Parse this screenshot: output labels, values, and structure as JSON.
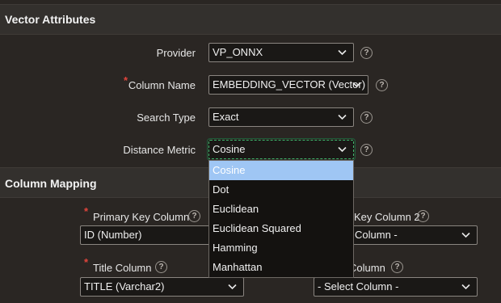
{
  "vector_attributes": {
    "title": "Vector Attributes",
    "provider": {
      "label": "Provider",
      "value": "VP_ONNX"
    },
    "column_name": {
      "label": "Column Name",
      "value": "EMBEDDING_VECTOR (Vector)"
    },
    "search_type": {
      "label": "Search Type",
      "value": "Exact"
    },
    "distance_metric": {
      "label": "Distance Metric",
      "value": "Cosine"
    },
    "required_marker": "*"
  },
  "distance_metric_options": [
    "Cosine",
    "Dot",
    "Euclidean",
    "Euclidean Squared",
    "Hamming",
    "Manhattan"
  ],
  "column_mapping": {
    "title": "Column Mapping",
    "primary_key": {
      "label": "Primary Key Column",
      "value": "ID (Number)"
    },
    "primary_key_2": {
      "label_partial": "Key Column 2",
      "value_partial": "Column -"
    },
    "title_column": {
      "label": "Title Column",
      "value": "TITLE (Varchar2)"
    },
    "fourth_column": {
      "label_partial": "Column",
      "value": "- Select Column -"
    },
    "required_marker": "*"
  },
  "help_glyph": "?",
  "icons": {
    "chevron": "chevron-down-icon",
    "help": "help-icon"
  },
  "colors": {
    "focus_ring": "#3fb56b",
    "selected_option": "#9fc6f4",
    "required": "#e2453c"
  }
}
